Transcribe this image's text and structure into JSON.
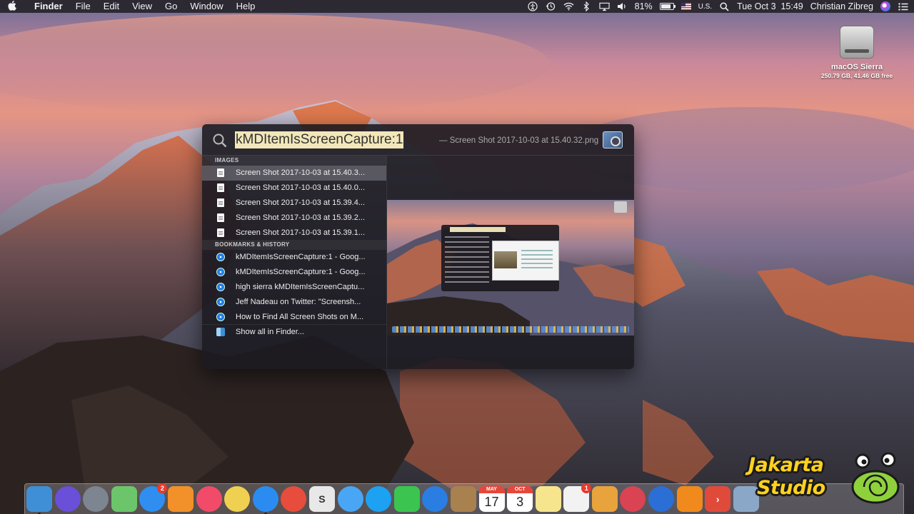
{
  "menubar": {
    "apple_icon": "apple-icon",
    "items": [
      "Finder",
      "File",
      "Edit",
      "View",
      "Go",
      "Window",
      "Help"
    ],
    "status": {
      "battery_percent": "81%",
      "battery_level": 0.81,
      "input_source": "U.S.",
      "datetime": "Tue Oct 3  15:49",
      "user": "Christian Zibreg"
    }
  },
  "desktop": {
    "drive": {
      "name": "macOS Sierra",
      "info": "250.79 GB, 41.46 GB free"
    }
  },
  "spotlight": {
    "query": "kMDItemIsScreenCapture:1",
    "suggestion": "— Screen Shot 2017-10-03 at 15.40.32.png",
    "sections": [
      {
        "title": "IMAGES",
        "rows": [
          {
            "label": "Screen Shot 2017-10-03 at 15.40.3...",
            "icon": "document-icon",
            "selected": true
          },
          {
            "label": "Screen Shot 2017-10-03 at 15.40.0...",
            "icon": "document-icon"
          },
          {
            "label": "Screen Shot 2017-10-03 at 15.39.4...",
            "icon": "document-icon"
          },
          {
            "label": "Screen Shot 2017-10-03 at 15.39.2...",
            "icon": "document-icon"
          },
          {
            "label": "Screen Shot 2017-10-03 at 15.39.1...",
            "icon": "document-icon"
          }
        ]
      },
      {
        "title": "BOOKMARKS & HISTORY",
        "rows": [
          {
            "label": "kMDItemIsScreenCapture:1 - Goog...",
            "icon": "safari-icon"
          },
          {
            "label": "kMDItemIsScreenCapture:1 - Goog...",
            "icon": "safari-icon"
          },
          {
            "label": "high sierra kMDItemIsScreenCaptu...",
            "icon": "safari-icon"
          },
          {
            "label": "Jeff Nadeau on Twitter: \"Screensh...",
            "icon": "safari-icon"
          },
          {
            "label": "How to Find All Screen Shots on M...",
            "icon": "safari-icon"
          }
        ]
      }
    ],
    "footer": "Show all in Finder...",
    "preview_label": "kMDItemIsScreenCapture:1"
  },
  "dock": {
    "items": [
      {
        "name": "finder",
        "color": "#3f8fd6",
        "running": true
      },
      {
        "name": "siri",
        "color": "#6a4fd8",
        "round": true
      },
      {
        "name": "launchpad",
        "color": "#7d8590",
        "round": true
      },
      {
        "name": "maps",
        "color": "#6cc56a"
      },
      {
        "name": "app-store",
        "color": "#2f8ef0",
        "round": true,
        "badge": "2"
      },
      {
        "name": "ibooks",
        "color": "#f2902a"
      },
      {
        "name": "itunes",
        "color": "#f24b6a",
        "round": true
      },
      {
        "name": "photos",
        "color": "#f0d050",
        "round": true
      },
      {
        "name": "safari",
        "color": "#2a8cf0",
        "round": true,
        "running": true
      },
      {
        "name": "chrome",
        "color": "#e74c3c",
        "round": true
      },
      {
        "name": "scrivener",
        "color": "#e8e8e8",
        "glyph": "S"
      },
      {
        "name": "messages-bubble",
        "color": "#49a6f4",
        "round": true
      },
      {
        "name": "twitter",
        "color": "#1da1f2",
        "round": true
      },
      {
        "name": "facetime",
        "color": "#3bc44f"
      },
      {
        "name": "directions",
        "color": "#2a7de1",
        "round": true
      },
      {
        "name": "notes-brown",
        "color": "#a9814e"
      },
      {
        "name": "calendar",
        "calendar": true,
        "month": "MAY",
        "day": "17"
      },
      {
        "name": "calendar-2",
        "calendar": true,
        "month": "OCT",
        "day": "3"
      },
      {
        "name": "stickies",
        "color": "#f6e58d"
      },
      {
        "name": "reminders",
        "color": "#f2f2f2",
        "badge": "1"
      },
      {
        "name": "preview",
        "color": "#e8a33c"
      },
      {
        "name": "lips-app",
        "color": "#d94352",
        "round": true
      },
      {
        "name": "1password",
        "color": "#2b6ed6",
        "round": true
      },
      {
        "name": "vlc",
        "color": "#f08a1c"
      },
      {
        "name": "pdf-app",
        "color": "#e04a3a",
        "glyph": "›"
      },
      {
        "name": "image-capture",
        "color": "#8aa7c8"
      }
    ]
  },
  "watermark": {
    "line1": "Jakarta",
    "line2": "Studio"
  }
}
